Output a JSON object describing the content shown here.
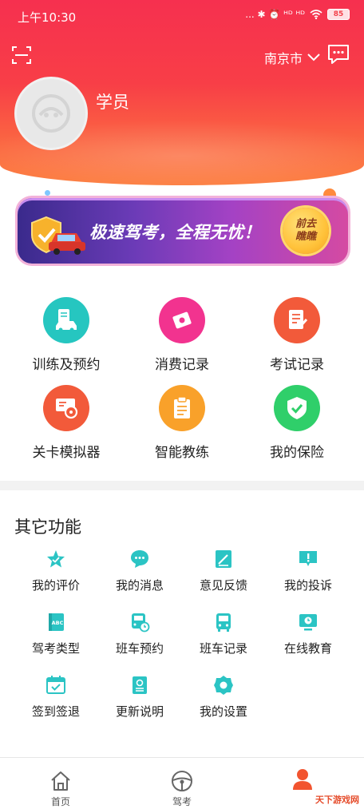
{
  "status_bar": {
    "time": "上午10:30",
    "indicators": "... ✱ ⏰ ᴴᴰ ᴴᴰ",
    "battery": "85"
  },
  "header": {
    "city": "南京市",
    "username": "学员"
  },
  "banner": {
    "text": "极速驾考，全程无忧！",
    "button_line1": "前去",
    "button_line2": "瞧瞧"
  },
  "main_features": [
    {
      "label": "训练及预约",
      "icon": "car-training-icon",
      "color": "#26c6c0"
    },
    {
      "label": "消费记录",
      "icon": "ticket-icon",
      "color": "#f2338f"
    },
    {
      "label": "考试记录",
      "icon": "exam-record-icon",
      "color": "#f25a3a"
    },
    {
      "label": "关卡模拟器",
      "icon": "steering-simulator-icon",
      "color": "#f25a3a"
    },
    {
      "label": "智能教练",
      "icon": "clipboard-icon",
      "color": "#f9a12a"
    },
    {
      "label": "我的保险",
      "icon": "shield-check-icon",
      "color": "#2fcf6a"
    }
  ],
  "other_section": {
    "title": "其它功能",
    "items": [
      {
        "label": "我的评价",
        "icon": "star-rating-icon"
      },
      {
        "label": "我的消息",
        "icon": "chat-bubble-icon"
      },
      {
        "label": "意见反馈",
        "icon": "edit-note-icon"
      },
      {
        "label": "我的投诉",
        "icon": "complaint-icon"
      },
      {
        "label": "驾考类型",
        "icon": "abc-book-icon"
      },
      {
        "label": "班车预约",
        "icon": "bus-clock-icon"
      },
      {
        "label": "班车记录",
        "icon": "bus-icon"
      },
      {
        "label": "在线教育",
        "icon": "monitor-clock-icon"
      },
      {
        "label": "签到签退",
        "icon": "calendar-check-icon"
      },
      {
        "label": "更新说明",
        "icon": "document-icon"
      },
      {
        "label": "我的设置",
        "icon": "gear-icon"
      }
    ],
    "accent_color": "#2bc4c4"
  },
  "tabbar": {
    "tabs": [
      {
        "label": "首页",
        "icon": "home-icon"
      },
      {
        "label": "驾考",
        "icon": "steering-wheel-icon"
      },
      {
        "label": "",
        "icon": "profile-icon"
      }
    ],
    "active_color": "#f2542f"
  },
  "colors": {
    "header_top": "#f6304f",
    "header_bottom": "#fc7e40"
  },
  "watermark": "天下游戏网"
}
